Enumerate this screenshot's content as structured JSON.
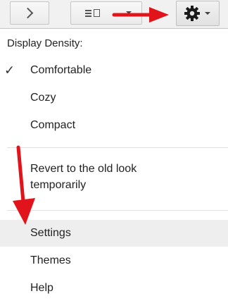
{
  "toolbar": {
    "next_icon": "chevron-right-icon",
    "view_icon": "split-view-icon",
    "settings_icon": "gear-icon"
  },
  "menu": {
    "header": "Display Density:",
    "density_options": [
      {
        "label": "Comfortable",
        "checked": true
      },
      {
        "label": "Cozy",
        "checked": false
      },
      {
        "label": "Compact",
        "checked": false
      }
    ],
    "revert_label": "Revert to the old look temporarily",
    "revert_line1": "Revert to the old look",
    "revert_line2": "temporarily",
    "settings_label": "Settings",
    "themes_label": "Themes",
    "help_label": "Help",
    "check_glyph": "✓"
  },
  "colors": {
    "arrow": "#e0141a",
    "highlight": "#eeeeee"
  }
}
